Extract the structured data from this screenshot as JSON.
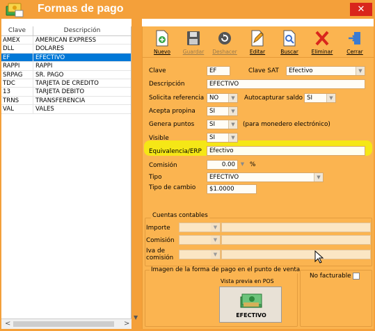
{
  "window": {
    "title": "Formas de pago",
    "close": "✕"
  },
  "list": {
    "headers": {
      "clave": "Clave",
      "descripcion": "Descripción"
    },
    "rows": [
      {
        "clave": "AMEX",
        "desc": "AMERICAN EXPRESS"
      },
      {
        "clave": "DLL",
        "desc": "DOLARES"
      },
      {
        "clave": "EF",
        "desc": "EFECTIVO"
      },
      {
        "clave": "RAPPI",
        "desc": "RAPPI"
      },
      {
        "clave": "SRPAG",
        "desc": "SR. PAGO"
      },
      {
        "clave": "TDC",
        "desc": "TARJETA DE CREDITO"
      },
      {
        "clave": "13",
        "desc": "TARJETA DEBITO"
      },
      {
        "clave": "TRNS",
        "desc": "TRANSFERENCIA"
      },
      {
        "clave": "VAL",
        "desc": "VALES"
      }
    ],
    "selected_index": 2,
    "scroll_left": "<",
    "scroll_right": ">"
  },
  "toolbar": {
    "nuevo": "Nuevo",
    "guardar": "Guardar",
    "deshacer": "Deshacer",
    "editar": "Editar",
    "buscar": "Buscar",
    "eliminar": "Eliminar",
    "cerrar": "Cerrar"
  },
  "form": {
    "clave_label": "Clave",
    "clave_value": "EF",
    "clave_sat_label": "Clave SAT",
    "clave_sat_value": "Efectivo",
    "descripcion_label": "Descripción",
    "descripcion_value": "EFECTIVO",
    "solicita_ref_label": "Solicita referencia",
    "solicita_ref_value": "NO",
    "autocapturar_label": "Autocapturar saldo",
    "autocapturar_value": "SI",
    "acepta_propina_label": "Acepta propina",
    "acepta_propina_value": "SI",
    "genera_puntos_label": "Genera puntos",
    "genera_puntos_value": "SI",
    "genera_puntos_note": "(para monedero electrónico)",
    "visible_label": "Visible",
    "visible_value": "SI",
    "equivalencia_label": "Equivalencia/ERP",
    "equivalencia_value": "Efectivo",
    "comision_label": "Comisión",
    "comision_value": "0.00",
    "comision_unit": "%",
    "tipo_label": "Tipo",
    "tipo_value": "EFECTIVO",
    "tipo_cambio_label": "Tipo de cambio",
    "tipo_cambio_value": "$1.0000"
  },
  "cuentas": {
    "title": "Cuentas contables",
    "importe_label": "Importe",
    "comision_label": "Comisión",
    "iva_label_1": "Iva de",
    "iva_label_2": "comisión"
  },
  "imagen": {
    "title": "Imagen de la forma de pago en el punto de venta",
    "vista_previa": "Vista previa en POS",
    "preview_label": "EFECTIVO",
    "no_facturable": "No facturable"
  },
  "colors": {
    "accent": "#f4a03a",
    "panel": "#fbb450",
    "selected": "#0078d7",
    "highlight": "#f3f00c",
    "close": "#d9261c"
  }
}
